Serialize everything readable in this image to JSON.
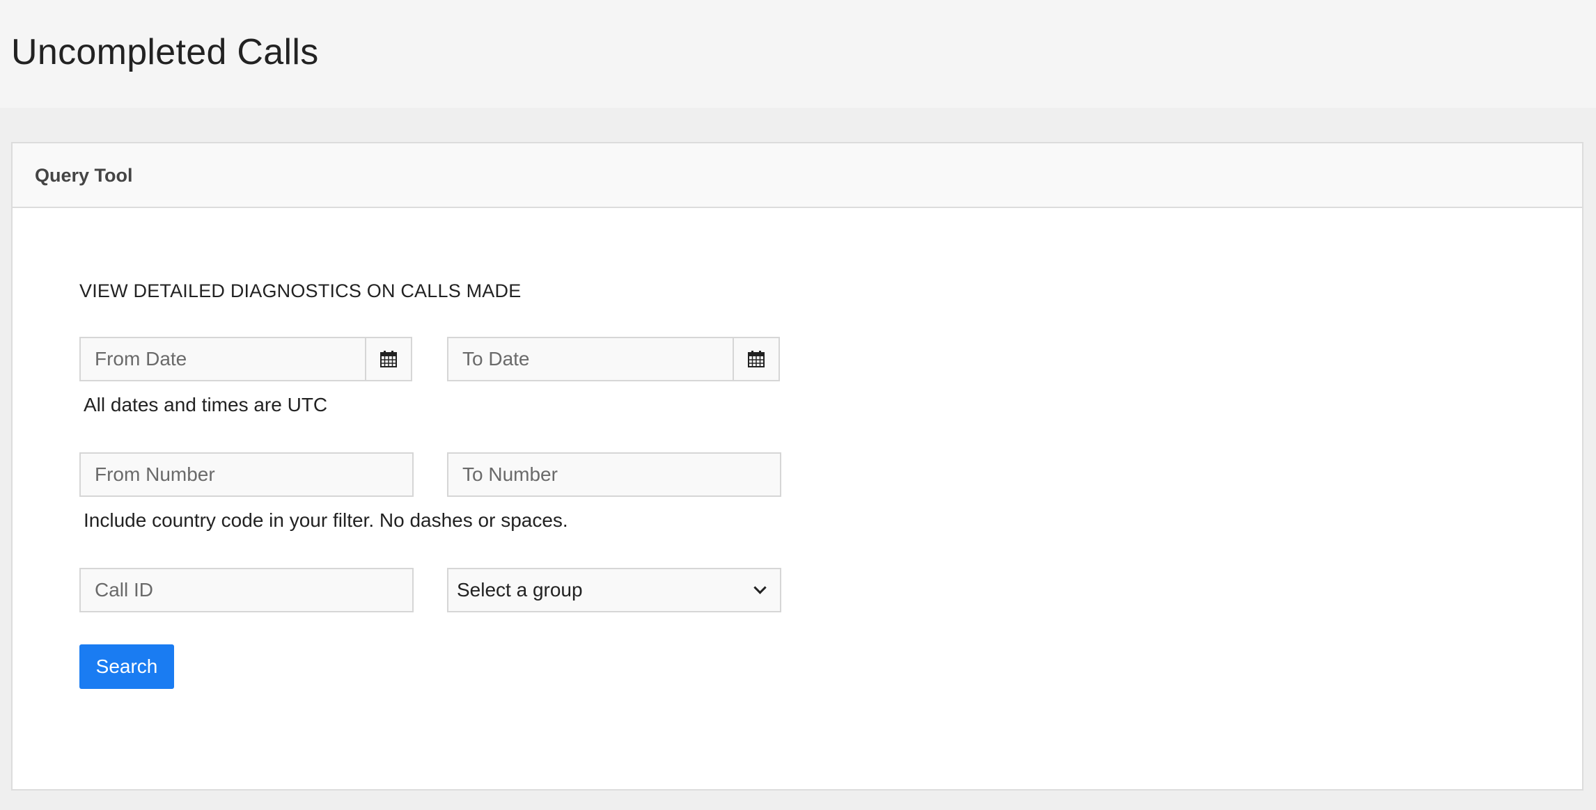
{
  "page": {
    "title": "Uncompleted Calls"
  },
  "query_tool": {
    "title": "Query Tool",
    "intro": "VIEW DETAILED DIAGNOSTICS ON CALLS MADE",
    "from_date": {
      "value": "",
      "placeholder": "From Date",
      "icon": "calendar-icon"
    },
    "to_date": {
      "value": "",
      "placeholder": "To Date",
      "icon": "calendar-icon"
    },
    "date_help": "All dates and times are UTC",
    "from_number": {
      "value": "",
      "placeholder": "From Number"
    },
    "to_number": {
      "value": "",
      "placeholder": "To Number"
    },
    "number_help": "Include country code in your filter. No dashes or spaces.",
    "call_id": {
      "value": "",
      "placeholder": "Call ID"
    },
    "group_select": {
      "selected": "Select a group",
      "icon": "chevron-down-icon"
    },
    "search_label": "Search"
  },
  "colors": {
    "accent": "#1a7cf2",
    "header_bg": "#f5f5f5",
    "page_bg": "#efefef",
    "field_bg": "#f9f9f9",
    "border": "#d6d6d6"
  }
}
